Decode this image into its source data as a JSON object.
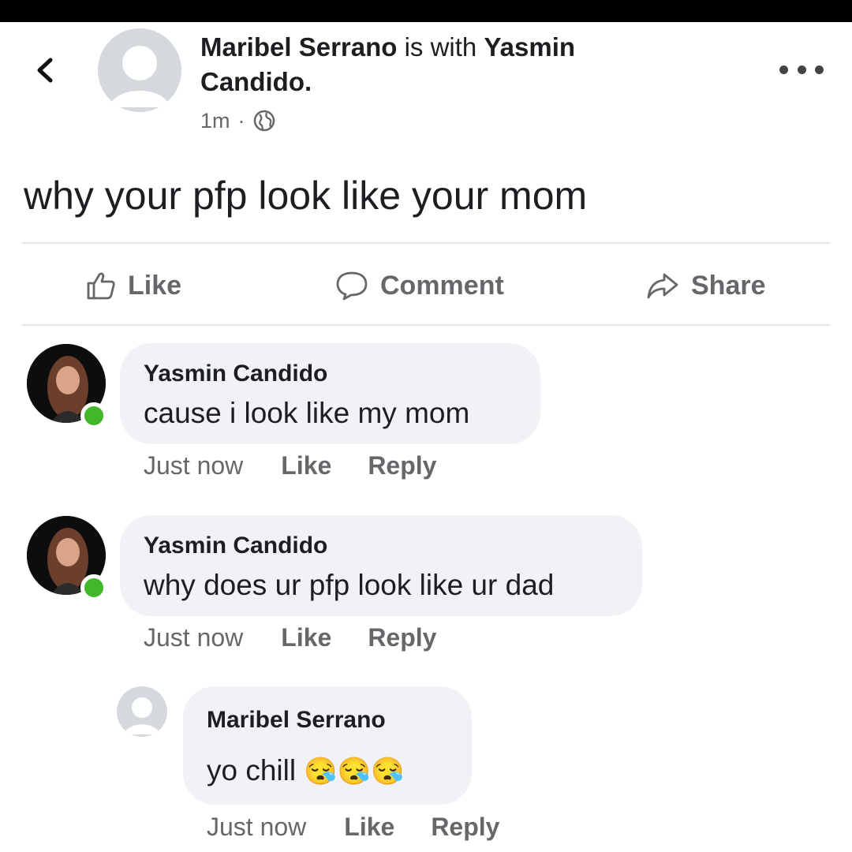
{
  "post": {
    "author": "Maribel Serrano",
    "with_text": "is with",
    "tagged": "Yasmin",
    "tagged_line2": "Candido.",
    "time": "1m",
    "separator": "·",
    "text": "why your pfp look like your mom"
  },
  "icons": {
    "back": "chevron-left-icon",
    "more": "more-dots-icon",
    "audience": "globe-icon",
    "like": "thumbs-up-icon",
    "comment": "speech-bubble-icon",
    "share": "share-arrow-icon",
    "emoji": "sleepy-face-emoji"
  },
  "actions": {
    "like": "Like",
    "comment": "Comment",
    "share": "Share"
  },
  "comments": [
    {
      "author": "Yasmin Candido",
      "text": "cause i look like my mom",
      "time": "Just now",
      "like": "Like",
      "reply": "Reply"
    },
    {
      "author": "Yasmin Candido",
      "text": "why does ur pfp look like ur dad",
      "time": "Just now",
      "like": "Like",
      "reply": "Reply"
    },
    {
      "author": "Maribel Serrano",
      "text": "yo chill",
      "emoji": "😪😪😪",
      "time": "Just now",
      "like": "Like",
      "reply": "Reply"
    }
  ],
  "colors": {
    "online": "#42b72a",
    "bubble": "#f0f2f5",
    "secondary_text": "#65676b"
  }
}
